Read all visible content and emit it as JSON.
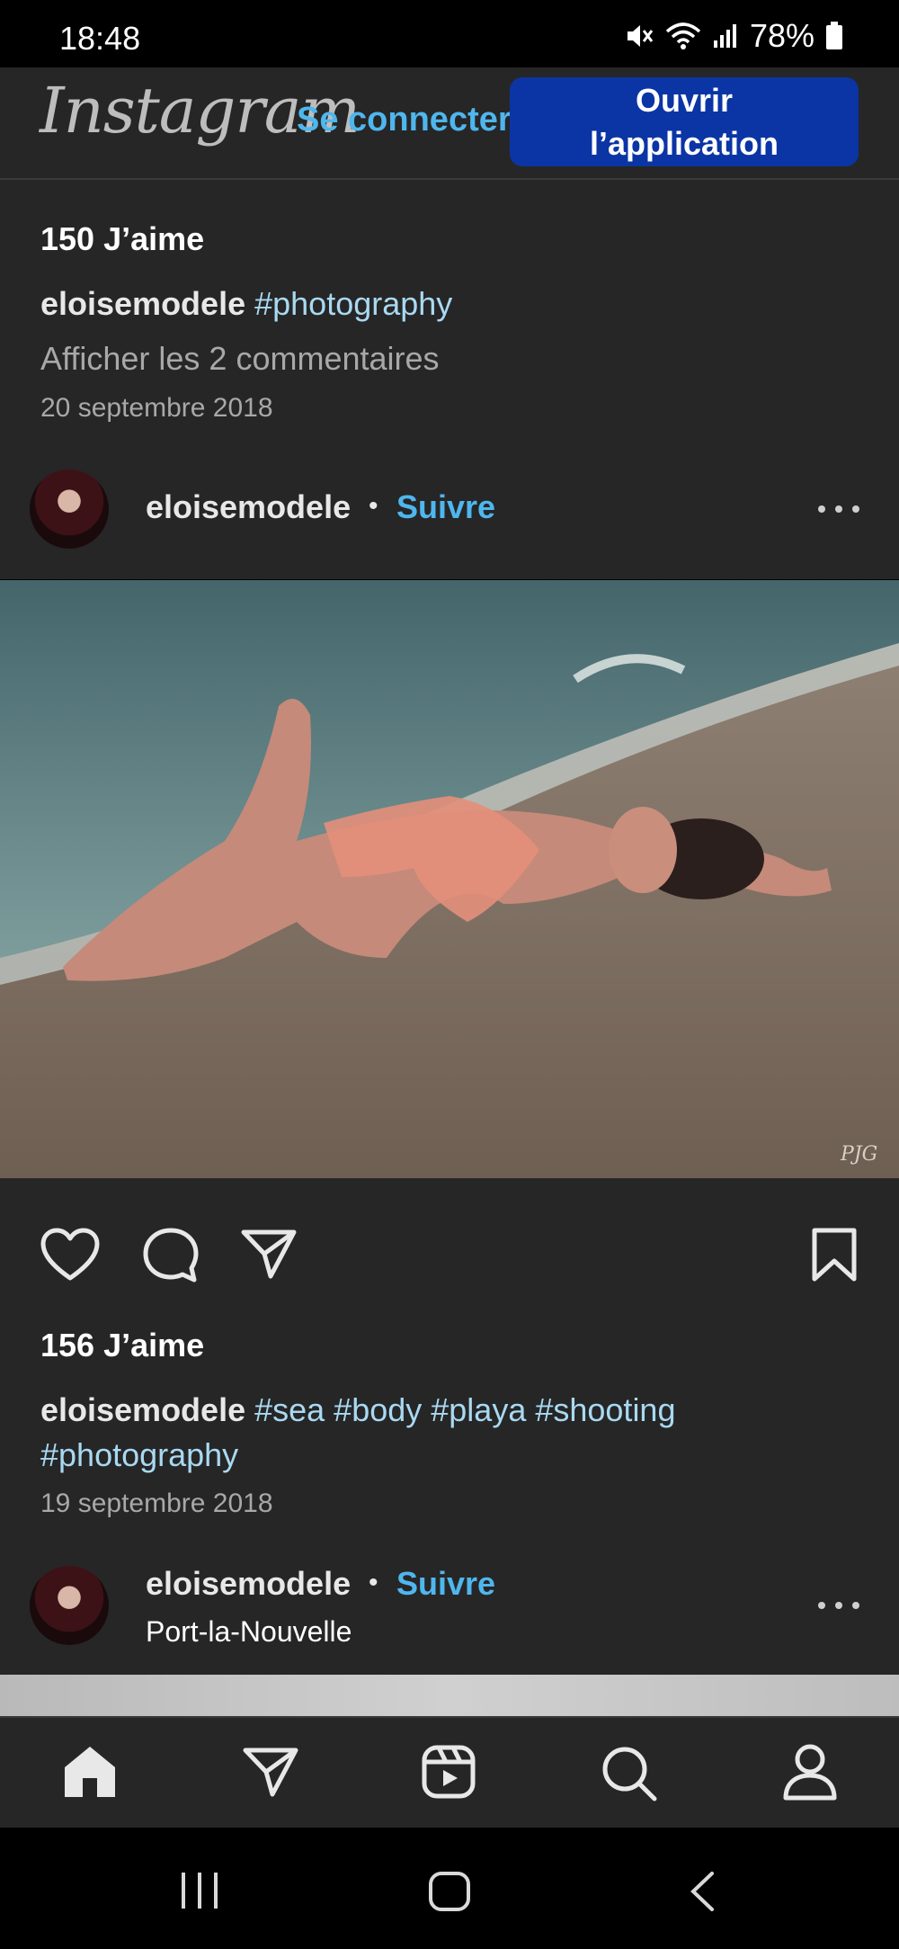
{
  "status_bar": {
    "time": "18:48",
    "battery": "78%",
    "icons": [
      "mute-icon",
      "wifi-icon",
      "signal-icon",
      "battery-icon"
    ]
  },
  "header": {
    "logo": "Instagram",
    "login_label": "Se connecter",
    "open_app_label": "Ouvrir l’application"
  },
  "post1": {
    "likes": "150 J’aime",
    "caption_user": "eloisemodele",
    "caption_tags": "#photography",
    "comments_link": "Afficher les 2 commentaires",
    "date": "20 septembre 2018"
  },
  "post2": {
    "username": "eloisemodele",
    "separator": "•",
    "follow_label": "Suivre",
    "watermark": "PJG",
    "likes": "156 J’aime",
    "caption_user": "eloisemodele",
    "caption_tags_line1": "#sea #body #playa #shooting",
    "caption_tags_line2": "#photography",
    "date": "19 septembre 2018"
  },
  "post3": {
    "username": "eloisemodele",
    "separator": "•",
    "follow_label": "Suivre",
    "location": "Port-la-Nouvelle"
  },
  "tabbar": {
    "items": [
      "home-icon",
      "direct-icon",
      "reels-icon",
      "search-icon",
      "profile-icon"
    ]
  },
  "system_nav": {
    "items": [
      "recent-apps-icon",
      "home-button-icon",
      "back-icon"
    ]
  },
  "colors": {
    "background": "#262626",
    "link": "#4fb6ee",
    "hashtag": "#a9d9f2",
    "primary_button": "#0b35a5"
  }
}
